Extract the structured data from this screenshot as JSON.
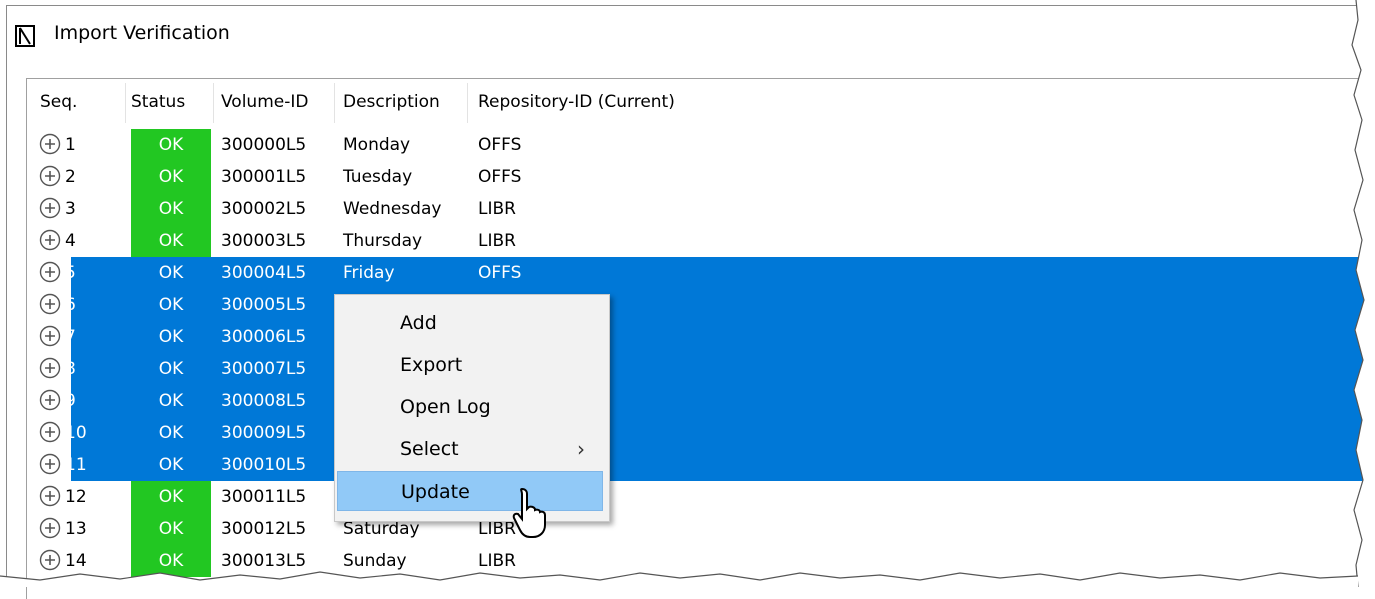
{
  "window": {
    "title": "Import Verification",
    "icon": "app-icon"
  },
  "columns": [
    "Seq.",
    "Status",
    "Volume-ID",
    "Description",
    "Repository-ID (Current)"
  ],
  "rows": [
    {
      "seq": "1",
      "status": "OK",
      "volume_id": "300000L5",
      "description": "Monday",
      "repository_id": "OFFS",
      "selected": false
    },
    {
      "seq": "2",
      "status": "OK",
      "volume_id": "300001L5",
      "description": "Tuesday",
      "repository_id": "OFFS",
      "selected": false
    },
    {
      "seq": "3",
      "status": "OK",
      "volume_id": "300002L5",
      "description": "Wednesday",
      "repository_id": "LIBR",
      "selected": false
    },
    {
      "seq": "4",
      "status": "OK",
      "volume_id": "300003L5",
      "description": "Thursday",
      "repository_id": "LIBR",
      "selected": false
    },
    {
      "seq": "5",
      "status": "OK",
      "volume_id": "300004L5",
      "description": "Friday",
      "repository_id": "OFFS",
      "selected": true
    },
    {
      "seq": "6",
      "status": "OK",
      "volume_id": "300005L5",
      "description": "",
      "repository_id": "",
      "selected": true
    },
    {
      "seq": "7",
      "status": "OK",
      "volume_id": "300006L5",
      "description": "",
      "repository_id": "",
      "selected": true
    },
    {
      "seq": "8",
      "status": "OK",
      "volume_id": "300007L5",
      "description": "",
      "repository_id": "",
      "selected": true
    },
    {
      "seq": "9",
      "status": "OK",
      "volume_id": "300008L5",
      "description": "",
      "repository_id": "",
      "selected": true
    },
    {
      "seq": "10",
      "status": "OK",
      "volume_id": "300009L5",
      "description": "",
      "repository_id": "",
      "selected": true
    },
    {
      "seq": "11",
      "status": "OK",
      "volume_id": "300010L5",
      "description": "",
      "repository_id": "",
      "selected": true
    },
    {
      "seq": "12",
      "status": "OK",
      "volume_id": "300011L5",
      "description": "",
      "repository_id": "",
      "selected": false
    },
    {
      "seq": "13",
      "status": "OK",
      "volume_id": "300012L5",
      "description": "Saturday",
      "repository_id": "LIBR",
      "selected": false
    },
    {
      "seq": "14",
      "status": "OK",
      "volume_id": "300013L5",
      "description": "Sunday",
      "repository_id": "LIBR",
      "selected": false
    }
  ],
  "context_menu": {
    "items": [
      {
        "label": "Add",
        "has_submenu": false,
        "hovered": false
      },
      {
        "label": "Export",
        "has_submenu": false,
        "hovered": false
      },
      {
        "label": "Open Log",
        "has_submenu": false,
        "hovered": false
      },
      {
        "label": "Select",
        "has_submenu": true,
        "hovered": false
      },
      {
        "label": "Update",
        "has_submenu": false,
        "hovered": true
      }
    ],
    "submenu_arrow": "›"
  },
  "colors": {
    "selection": "#0078d7",
    "status_ok": "#22c722",
    "menu_hover": "#91c9f7"
  }
}
